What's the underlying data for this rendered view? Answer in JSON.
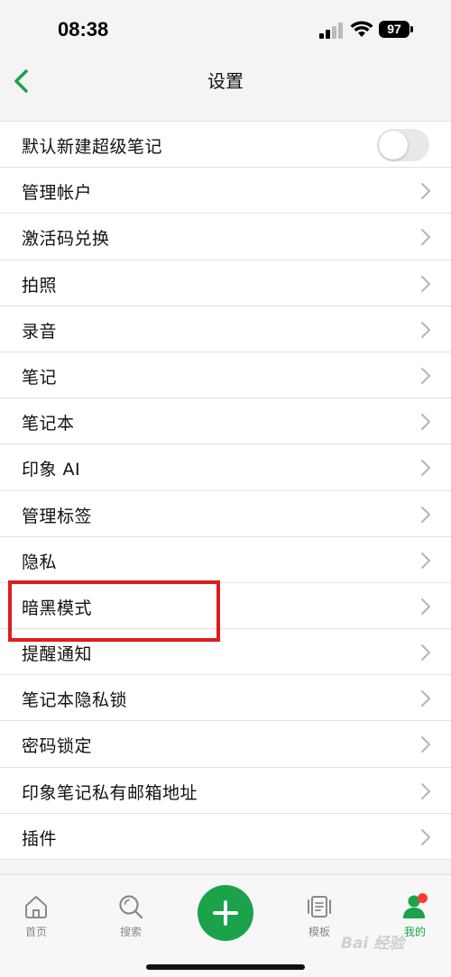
{
  "status_bar": {
    "time": "08:38",
    "battery": "97",
    "signal_icon": "cellular-signal-icon",
    "wifi_icon": "wifi-icon"
  },
  "nav": {
    "title": "设置",
    "back_icon": "chevron-left-icon",
    "accent_color": "#1aa34a"
  },
  "settings": {
    "toggle_row": {
      "label": "默认新建超级笔记",
      "enabled": false
    },
    "items": [
      {
        "label": "管理帐户"
      },
      {
        "label": "激活码兑换"
      },
      {
        "label": "拍照"
      },
      {
        "label": "录音"
      },
      {
        "label": "笔记"
      },
      {
        "label": "笔记本"
      },
      {
        "label": "印象 AI"
      },
      {
        "label": "管理标签"
      },
      {
        "label": "隐私"
      },
      {
        "label": "暗黑模式"
      },
      {
        "label": "提醒通知"
      },
      {
        "label": "笔记本隐私锁"
      },
      {
        "label": "密码锁定"
      },
      {
        "label": "印象笔记私有邮箱地址"
      },
      {
        "label": "插件"
      }
    ],
    "highlight_color": "#e01b1b"
  },
  "tab_bar": {
    "tabs": [
      {
        "label": "首页",
        "icon": "home-icon"
      },
      {
        "label": "搜索",
        "icon": "search-icon"
      },
      {
        "label": "模板",
        "icon": "template-icon"
      },
      {
        "label": "我的",
        "icon": "user-icon",
        "active": true
      }
    ],
    "add_icon": "plus-icon"
  },
  "watermark": "Bai 经验"
}
